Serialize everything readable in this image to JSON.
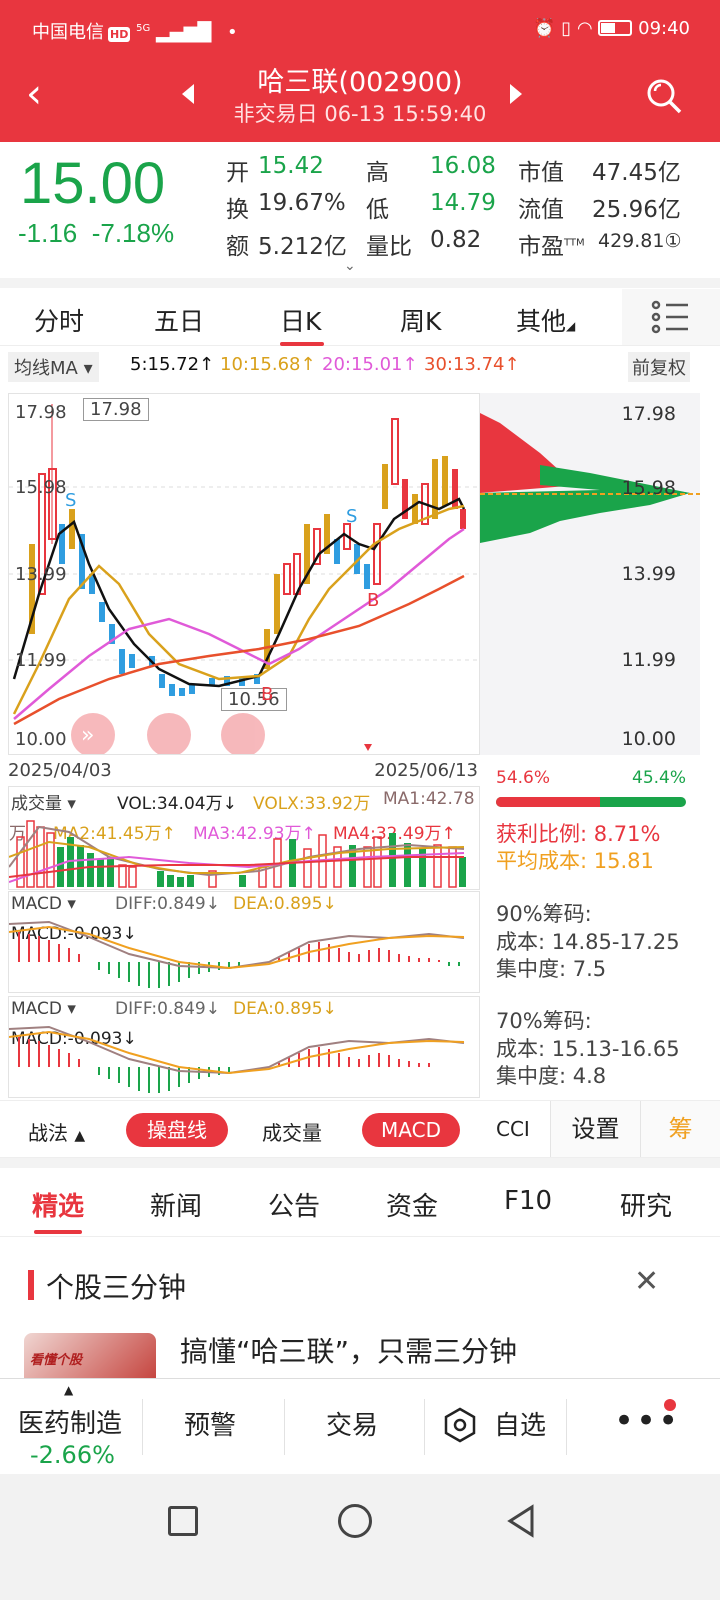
{
  "status": {
    "carrier": "中国电信",
    "hd": "HD",
    "net": "5G",
    "time": "09:40"
  },
  "header": {
    "title": "哈三联(002900)",
    "subtitle": "非交易日  06-13 15:59:40"
  },
  "quote": {
    "price": "15.00",
    "change": "-1.16",
    "change_pct": "-7.18%",
    "fields": [
      {
        "label": "开",
        "value": "15.42"
      },
      {
        "label": "高",
        "value": "16.08"
      },
      {
        "label": "市值",
        "value": "47.45亿"
      },
      {
        "label": "换",
        "value": "19.67%"
      },
      {
        "label": "低",
        "value": "14.79"
      },
      {
        "label": "流值",
        "value": "25.96亿"
      },
      {
        "label": "额",
        "value": "5.212亿"
      },
      {
        "label": "量比",
        "value": "0.82"
      },
      {
        "label": "市盈",
        "sup": "TTM",
        "value": "429.81①"
      }
    ]
  },
  "ktabs": [
    "分时",
    "五日",
    "日K",
    "周K",
    "其他"
  ],
  "ma": {
    "label": "均线MA",
    "ma5": "5:15.72↑",
    "ma10": "10:15.68↑",
    "ma20": "20:15.01↑",
    "ma30": "30:13.74↑",
    "adjust": "前复权"
  },
  "kchart": {
    "high_label": "17.98",
    "low_label": "10.56",
    "y_labels": [
      "17.98",
      "15.98",
      "13.99",
      "11.99",
      "10.00"
    ],
    "start_date": "2025/04/03",
    "end_date": "2025/06/13",
    "signals": {
      "s": "S",
      "b": "B"
    }
  },
  "chips": {
    "y_labels": [
      "17.98",
      "15.98",
      "13.99",
      "11.99",
      "10.00"
    ],
    "profit_pct": "54.6%",
    "loss_pct": "45.4%",
    "profit_ratio_label": "获利比例:",
    "profit_ratio": "8.71%",
    "avg_cost_label": "平均成本:",
    "avg_cost": "15.81",
    "c90_title": "90%筹码:",
    "c90_cost": "成本: 14.85-17.25",
    "c90_conc": "集中度: 7.5",
    "c70_title": "70%筹码:",
    "c70_cost": "成本: 15.13-16.65",
    "c70_conc": "集中度: 4.8"
  },
  "volume": {
    "label": "成交量",
    "vol": "VOL:34.04万↓",
    "volx": "VOLX:33.92万",
    "ma1": "MA1:42.78",
    "unit": "万",
    "ma2": "MA2:41.45万↑",
    "ma3": "MA3:42.93万↑",
    "ma4": "MA4:32.49万↑"
  },
  "macd": {
    "label": "MACD",
    "diff": "DIFF:0.849↓",
    "dea": "DEA:0.895↓",
    "macd": "MACD:-0.093↓"
  },
  "indicators": {
    "zhanfa": "战法",
    "caopan": "操盘线",
    "volume": "成交量",
    "macd": "MACD",
    "cci": "CCI",
    "settings": "设置",
    "chou": "筹"
  },
  "news_tabs": [
    "精选",
    "新闻",
    "公告",
    "资金",
    "F10",
    "研究"
  ],
  "section": {
    "title": "个股三分钟",
    "article": "搞懂“哈三联”，只需三分钟",
    "thumb_text": "看懂个股"
  },
  "bottom": {
    "sector": "医药制造",
    "sector_change": "-2.66%",
    "alert": "预警",
    "trade": "交易",
    "watch": "自选"
  },
  "colors": {
    "brand": "#e8363f",
    "up": "#e8363f",
    "down": "#1aa44a",
    "ma5": "#111111",
    "ma10": "#d9a11c",
    "ma20": "#e05ad8",
    "ma30": "#e8502c"
  }
}
